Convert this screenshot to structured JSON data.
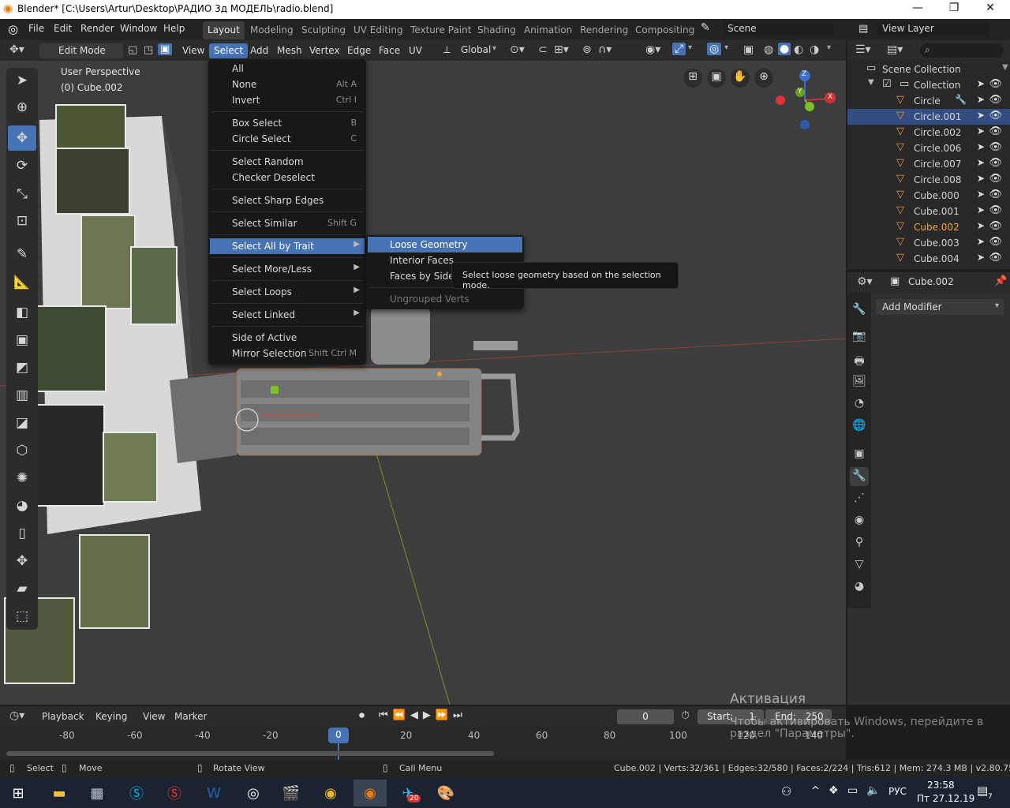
{
  "window": {
    "title": "Blender* [C:\\Users\\Artur\\Desktop\\РАДИО 3д МОДЕЛЬ\\radio.blend]",
    "minimize": "—",
    "maximize": "❐",
    "close": "✕"
  },
  "top_menu": [
    "File",
    "Edit",
    "Render",
    "Window",
    "Help"
  ],
  "workspace_tabs": [
    "Layout",
    "Modeling",
    "Sculpting",
    "UV Editing",
    "Texture Paint",
    "Shading",
    "Animation",
    "Rendering",
    "Compositing"
  ],
  "scene": {
    "label": "Scene",
    "view_layer": "View Layer"
  },
  "viewport_header": {
    "mode": "Edit Mode",
    "menus": [
      "View",
      "Select",
      "Add",
      "Mesh",
      "Vertex",
      "Edge",
      "Face",
      "UV"
    ],
    "active_menu": "Select",
    "orientation": "Global"
  },
  "viewport": {
    "perspective": "User Perspective",
    "object": "(0) Cube.002",
    "axes": {
      "x": "X",
      "y": "Y",
      "z": "Z"
    }
  },
  "select_menu": {
    "items": [
      {
        "label": "All",
        "shortcut": ""
      },
      {
        "label": "None",
        "shortcut": "Alt A"
      },
      {
        "label": "Invert",
        "shortcut": "Ctrl I"
      },
      {
        "label": "Box Select",
        "shortcut": "B"
      },
      {
        "label": "Circle Select",
        "shortcut": "C"
      },
      {
        "label": "Select Random",
        "shortcut": ""
      },
      {
        "label": "Checker Deselect",
        "shortcut": ""
      },
      {
        "label": "Select Sharp Edges",
        "shortcut": ""
      },
      {
        "label": "Select Similar",
        "shortcut": "Shift G"
      },
      {
        "label": "Select All by Trait",
        "shortcut": ""
      },
      {
        "label": "Select More/Less",
        "shortcut": ""
      },
      {
        "label": "Select Loops",
        "shortcut": ""
      },
      {
        "label": "Select Linked",
        "shortcut": ""
      },
      {
        "label": "Side of Active",
        "shortcut": ""
      },
      {
        "label": "Mirror Selection",
        "shortcut": "Shift Ctrl M"
      }
    ]
  },
  "trait_submenu": {
    "items": [
      "Loose Geometry",
      "Interior Faces",
      "Faces by Sides",
      "Ungrouped Verts"
    ],
    "highlighted": "Loose Geometry"
  },
  "tooltip": "Select loose geometry based on the selection mode.",
  "outliner": {
    "scene_collection": "Scene Collection",
    "collection": "Collection",
    "objects": [
      "Circle",
      "Circle.001",
      "Circle.002",
      "Circle.006",
      "Circle.007",
      "Circle.008",
      "Cube.000",
      "Cube.001",
      "Cube.002",
      "Cube.003",
      "Cube.004"
    ],
    "selected": "Circle.001",
    "active": "Cube.002"
  },
  "properties": {
    "object_name": "Cube.002",
    "add_modifier": "Add Modifier"
  },
  "timeline": {
    "menus": [
      "Playback",
      "Keying",
      "View",
      "Marker"
    ],
    "current_frame": "0",
    "start_label": "Start:",
    "start": "1",
    "end_label": "End:",
    "end": "250",
    "ticks": [
      "-80",
      "-60",
      "-40",
      "-20",
      "0",
      "20",
      "40",
      "60",
      "80",
      "100",
      "120",
      "140"
    ]
  },
  "watermark": {
    "title": "Активация Windows",
    "line2": "Чтобы активировать Windows, перейдите в",
    "line3": "раздел \"Параметры\"."
  },
  "statusbar": {
    "select": "Select",
    "move": "Move",
    "rotate": "Rotate View",
    "call_menu": "Call Menu",
    "stats": "Cube.002 | Verts:32/361 | Edges:32/580 | Faces:2/224 | Tris:612 | Mem: 274.3 MB | v2.80.75"
  },
  "taskbar": {
    "lang": "РУС",
    "time": "23:58",
    "date": "Пт 27.12.19",
    "telegram_badge": "20",
    "notifications": "7"
  },
  "colors": {
    "accent": "#4772b3",
    "active_object": "#e59540",
    "viewport_bg": "#3d3d3d"
  }
}
